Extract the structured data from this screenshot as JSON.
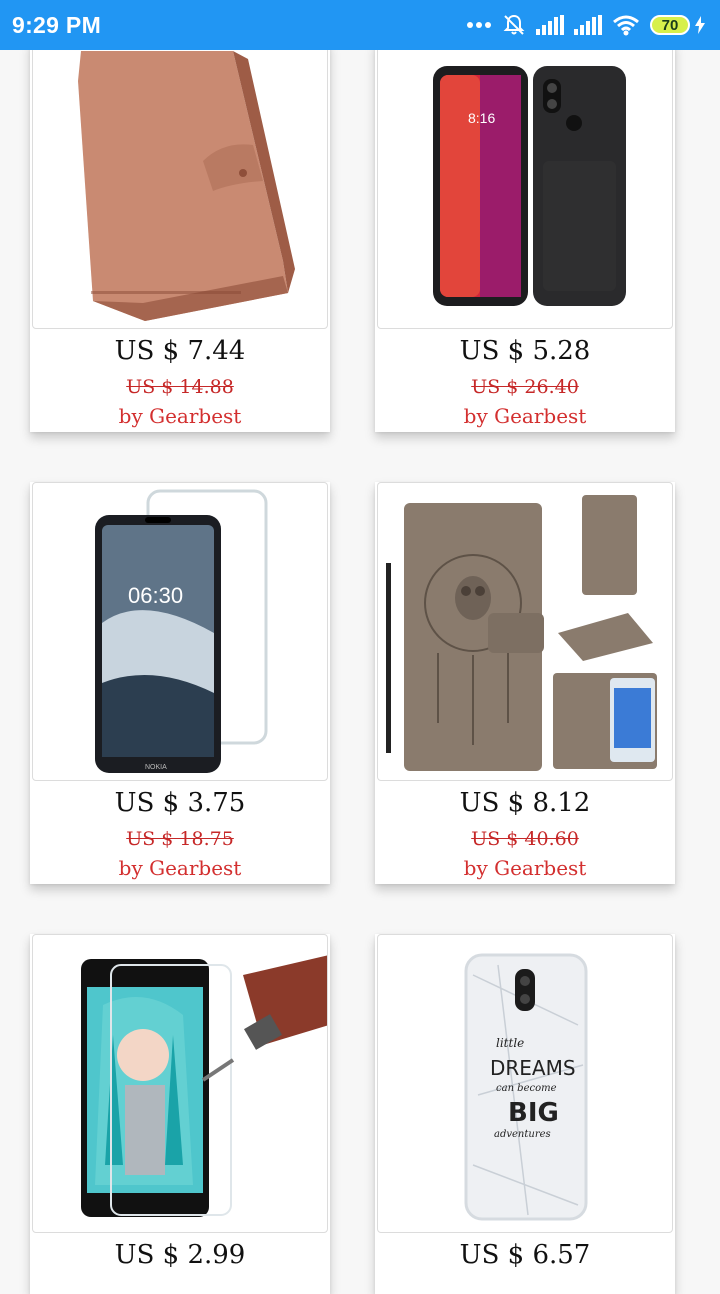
{
  "status_bar": {
    "time": "9:29 PM",
    "battery": "70"
  },
  "products": [
    {
      "price": "US $ 7.44",
      "old_price": "US $ 14.88",
      "seller": "by Gearbest",
      "image": "brown-leather-wallet-case"
    },
    {
      "price": "US $ 5.28",
      "old_price": "US $ 26.40",
      "seller": "by Gearbest",
      "image": "black-carbon-fiber-phone-case"
    },
    {
      "price": "US $ 3.75",
      "old_price": "US $ 18.75",
      "seller": "by Gearbest",
      "image": "tempered-glass-screen-protector"
    },
    {
      "price": "US $ 8.12",
      "old_price": "US $ 40.60",
      "seller": "by Gearbest",
      "image": "owl-dreamcatcher-wallet-case"
    },
    {
      "price": "US $ 2.99",
      "image": "anime-screen-protector-with-drill"
    },
    {
      "price": "US $ 6.57",
      "image": "marble-dreams-phone-case"
    }
  ],
  "colors": {
    "status_bar": "#2196f3",
    "price": "#111111",
    "old_price": "#c62828",
    "seller": "#d32f2f"
  }
}
